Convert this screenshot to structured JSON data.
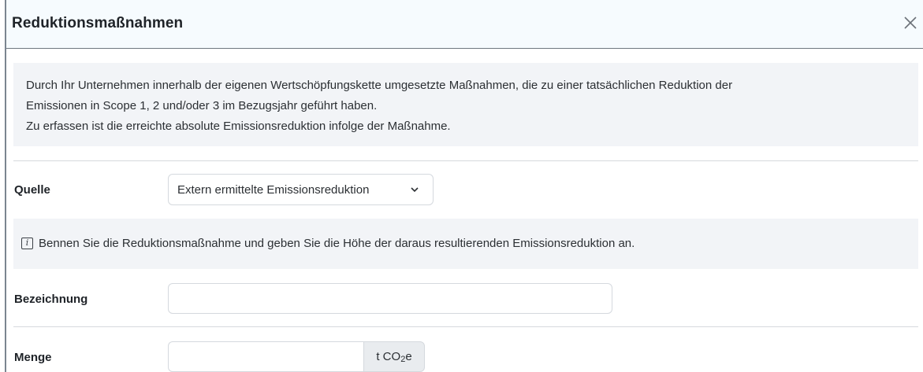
{
  "dialog": {
    "title": "Reduktionsmaßnahmen"
  },
  "description": {
    "line1": "Durch Ihr Unternehmen innerhalb der eigenen Wertschöpfungskette umgesetzte Maßnahmen, die zu einer tatsächlichen Reduktion der",
    "line2": "Emissionen in Scope 1, 2 und/oder 3 im Bezugsjahr geführt haben.",
    "line3": "Zu erfassen ist die erreichte absolute Emissionsreduktion infolge der Maßnahme."
  },
  "source": {
    "label": "Quelle",
    "selected": "Extern ermittelte Emissionsreduktion"
  },
  "info": {
    "icon_letter": "i",
    "text": "Bennen Sie die Reduktionsmaßnahme und geben Sie die Höhe der daraus resultierenden Emissionsreduktion an."
  },
  "designation": {
    "label": "Bezeichnung",
    "value": ""
  },
  "amount": {
    "label": "Menge",
    "value": "",
    "unit_prefix": "t CO",
    "unit_sub": "2",
    "unit_suffix": "e"
  },
  "icons": {
    "close": "close-icon",
    "chevron": "chevron-down-icon",
    "info": "info-icon"
  },
  "colors": {
    "header_bg": "#f6fbfe",
    "panel_bg": "#f2f4f7",
    "addon_bg": "#e9ecef",
    "border": "#d5d9de"
  }
}
